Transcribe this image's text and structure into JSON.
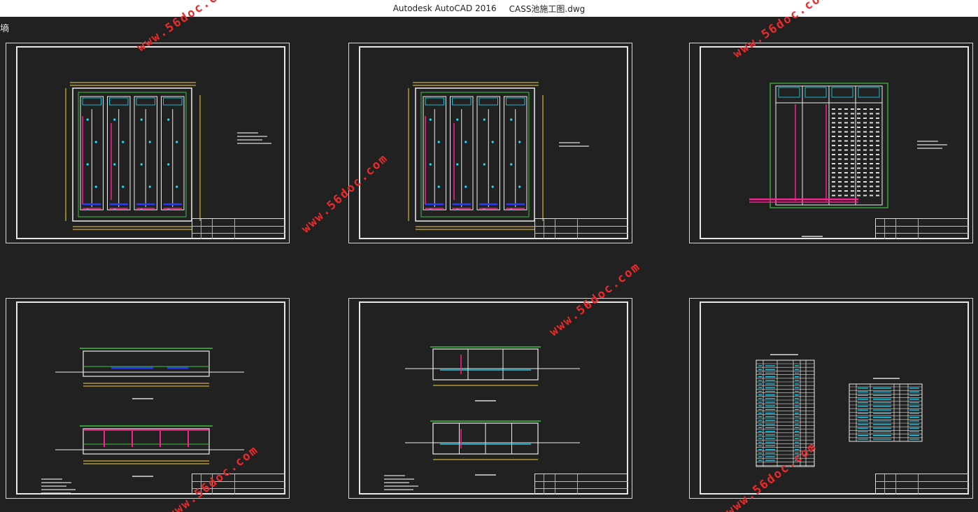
{
  "window": {
    "app_name": "Autodesk AutoCAD 2016",
    "file_name": "CASS池施工图.dwg"
  },
  "toolbar_glyph": "墒",
  "watermark": "www.56doc.com",
  "colors": {
    "background": "#212121",
    "frame": "#e8e8e8",
    "dim_yellow": "#ffd23a",
    "green": "#3fbf3f",
    "magenta": "#ff1f8f",
    "cyan": "#1fe0ff",
    "blue": "#2a3bff",
    "watermark": "#ee2a2a"
  },
  "sheets": [
    {
      "id": "plan",
      "kind": "plan"
    },
    {
      "id": "plan-inlet",
      "kind": "plan2"
    },
    {
      "id": "plan-aeration",
      "kind": "aeration"
    },
    {
      "id": "section-a-b",
      "kind": "section"
    },
    {
      "id": "section-1-2",
      "kind": "section2"
    },
    {
      "id": "schedules",
      "kind": "tables"
    }
  ]
}
